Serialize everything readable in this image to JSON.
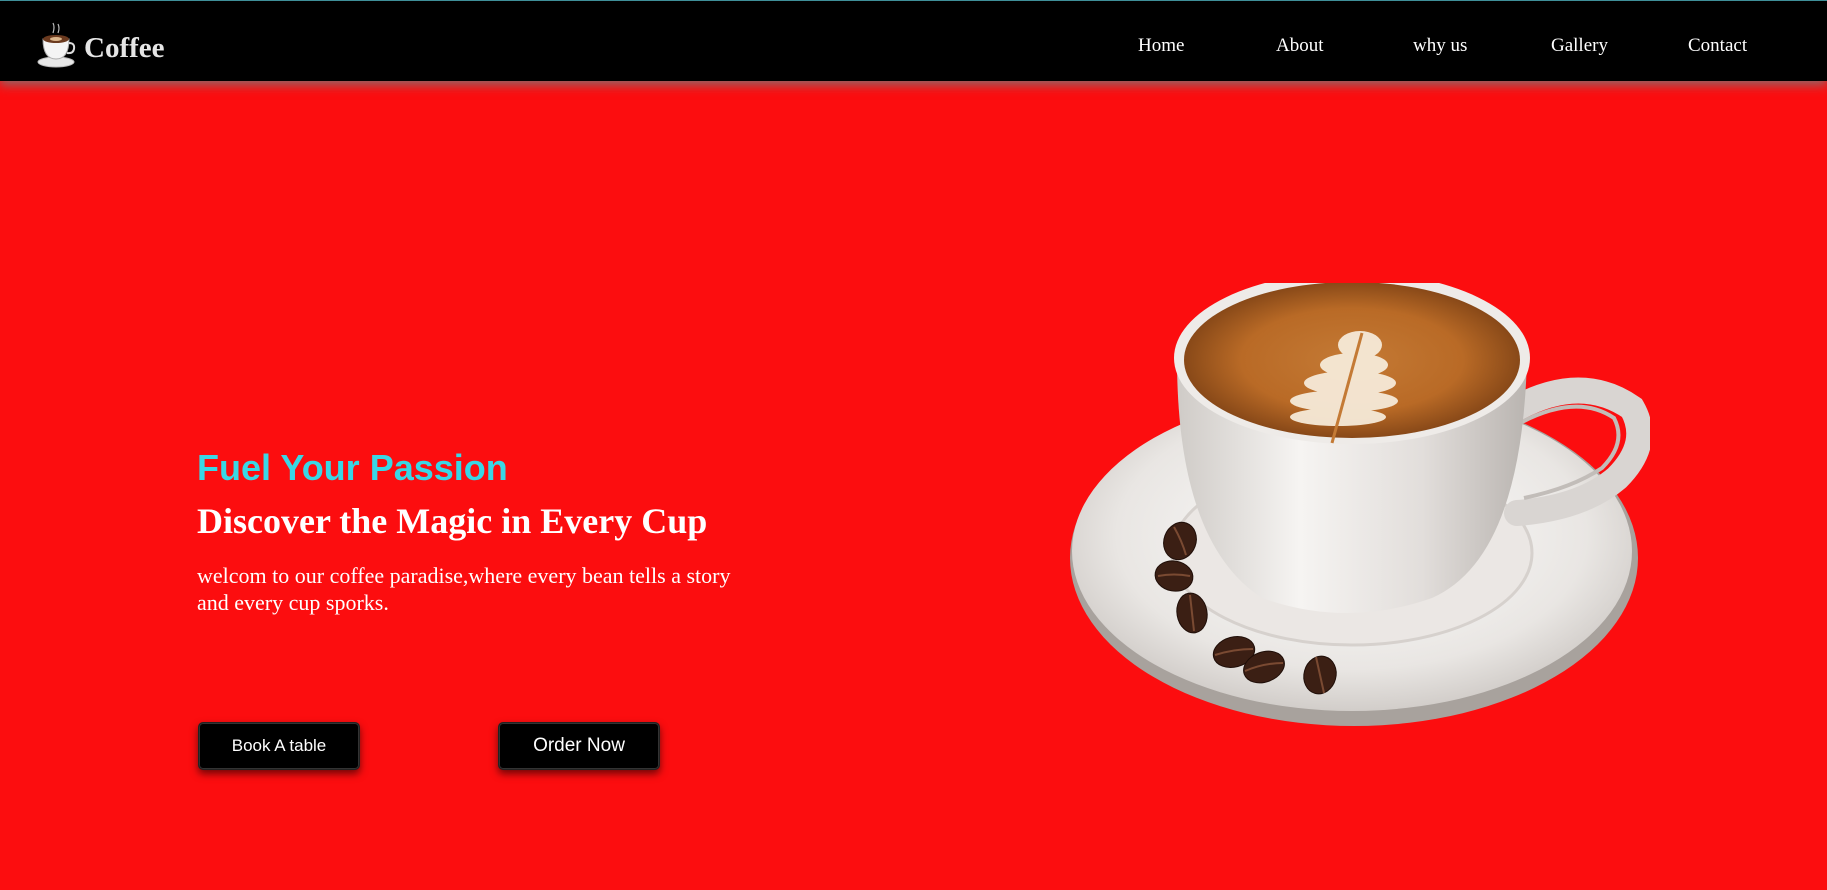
{
  "brand": {
    "name": "Coffee",
    "logo_icon": "coffee-cup-icon"
  },
  "nav": {
    "items": [
      {
        "label": "Home"
      },
      {
        "label": "About"
      },
      {
        "label": "why us"
      },
      {
        "label": "Gallery"
      },
      {
        "label": "Contact"
      }
    ]
  },
  "hero": {
    "title": "Fuel Your Passion",
    "subtitle": "Discover the Magic in Every Cup",
    "text": "welcom to our coffee paradise,where every bean tells a story and every cup sporks.",
    "book_label": "Book A table",
    "order_label": "Order Now",
    "image": "latte-cup-on-saucer-with-coffee-beans"
  },
  "colors": {
    "background": "#fc0d0f",
    "navbar": "#000000",
    "accent": "#39d7e6",
    "button": "#000000"
  }
}
